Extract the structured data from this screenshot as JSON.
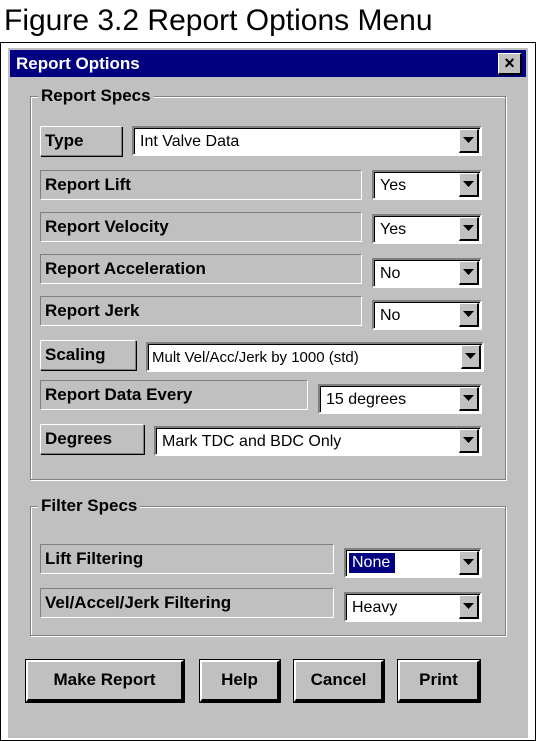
{
  "caption": "Figure 3.2  Report Options Menu",
  "window": {
    "title": "Report Options",
    "close_label": "×"
  },
  "report_specs": {
    "legend": "Report Specs",
    "type": {
      "label": "Type",
      "value": "Int Valve Data"
    },
    "report_lift": {
      "label": "Report Lift",
      "value": "Yes"
    },
    "report_velocity": {
      "label": "Report Velocity",
      "value": "Yes"
    },
    "report_acceleration": {
      "label": "Report Acceleration",
      "value": "No"
    },
    "report_jerk": {
      "label": "Report Jerk",
      "value": "No"
    },
    "scaling": {
      "label": "Scaling",
      "value": "Mult Vel/Acc/Jerk by 1000 (std)"
    },
    "report_data_every": {
      "label": "Report Data Every",
      "value": "15 degrees"
    },
    "degrees": {
      "label": "Degrees",
      "value": "Mark TDC and BDC Only"
    }
  },
  "filter_specs": {
    "legend": "Filter Specs",
    "lift_filtering": {
      "label": "Lift Filtering",
      "value": "None"
    },
    "vaj_filtering": {
      "label": "Vel/Accel/Jerk Filtering",
      "value": "Heavy"
    }
  },
  "buttons": {
    "make_report": "Make Report",
    "help": "Help",
    "cancel": "Cancel",
    "print": "Print"
  },
  "colors": {
    "dialog_bg": "#c0c0c0",
    "titlebar": "#000080",
    "selection": "#000080"
  }
}
